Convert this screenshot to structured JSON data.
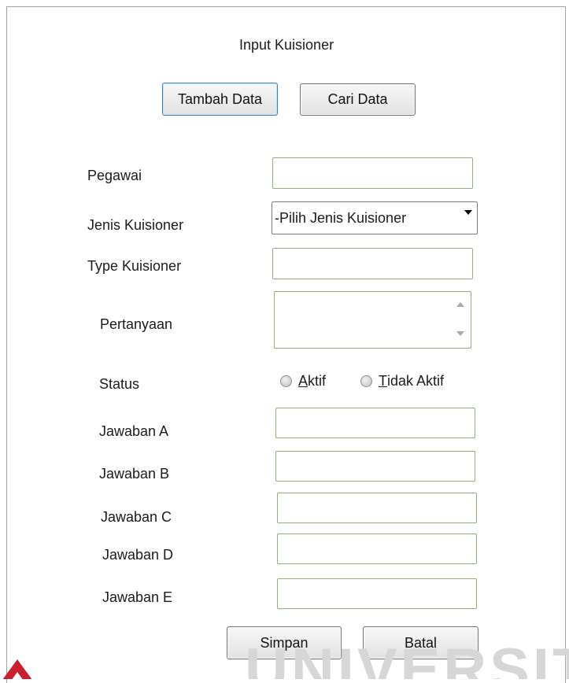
{
  "form": {
    "title": "Input Kuisioner",
    "buttons": {
      "add": "Tambah Data",
      "search": "Cari Data"
    },
    "fields": {
      "pegawai": {
        "label": "Pegawai",
        "value": ""
      },
      "jenis": {
        "label": "Jenis Kuisioner",
        "selected": "-Pilih Jenis Kuisioner"
      },
      "type": {
        "label": "Type Kuisioner",
        "value": ""
      },
      "pertanyaan": {
        "label": "Pertanyaan",
        "value": ""
      },
      "status": {
        "label": "Status",
        "options": [
          {
            "access_key": "A",
            "rest": "ktif"
          },
          {
            "access_key": "T",
            "rest": "idak Aktif"
          }
        ]
      },
      "jawaban_a": {
        "label": "Jawaban A",
        "value": ""
      },
      "jawaban_b": {
        "label": "Jawaban B",
        "value": ""
      },
      "jawaban_c": {
        "label": "Jawaban C",
        "value": ""
      },
      "jawaban_d": {
        "label": "Jawaban D",
        "value": ""
      },
      "jawaban_e": {
        "label": "Jawaban E",
        "value": ""
      }
    },
    "footer": {
      "save": "Simpan",
      "cancel": "Batal"
    }
  },
  "watermark": {
    "text": "UNIVERSITAS",
    "logo_color": "#c8202f"
  }
}
